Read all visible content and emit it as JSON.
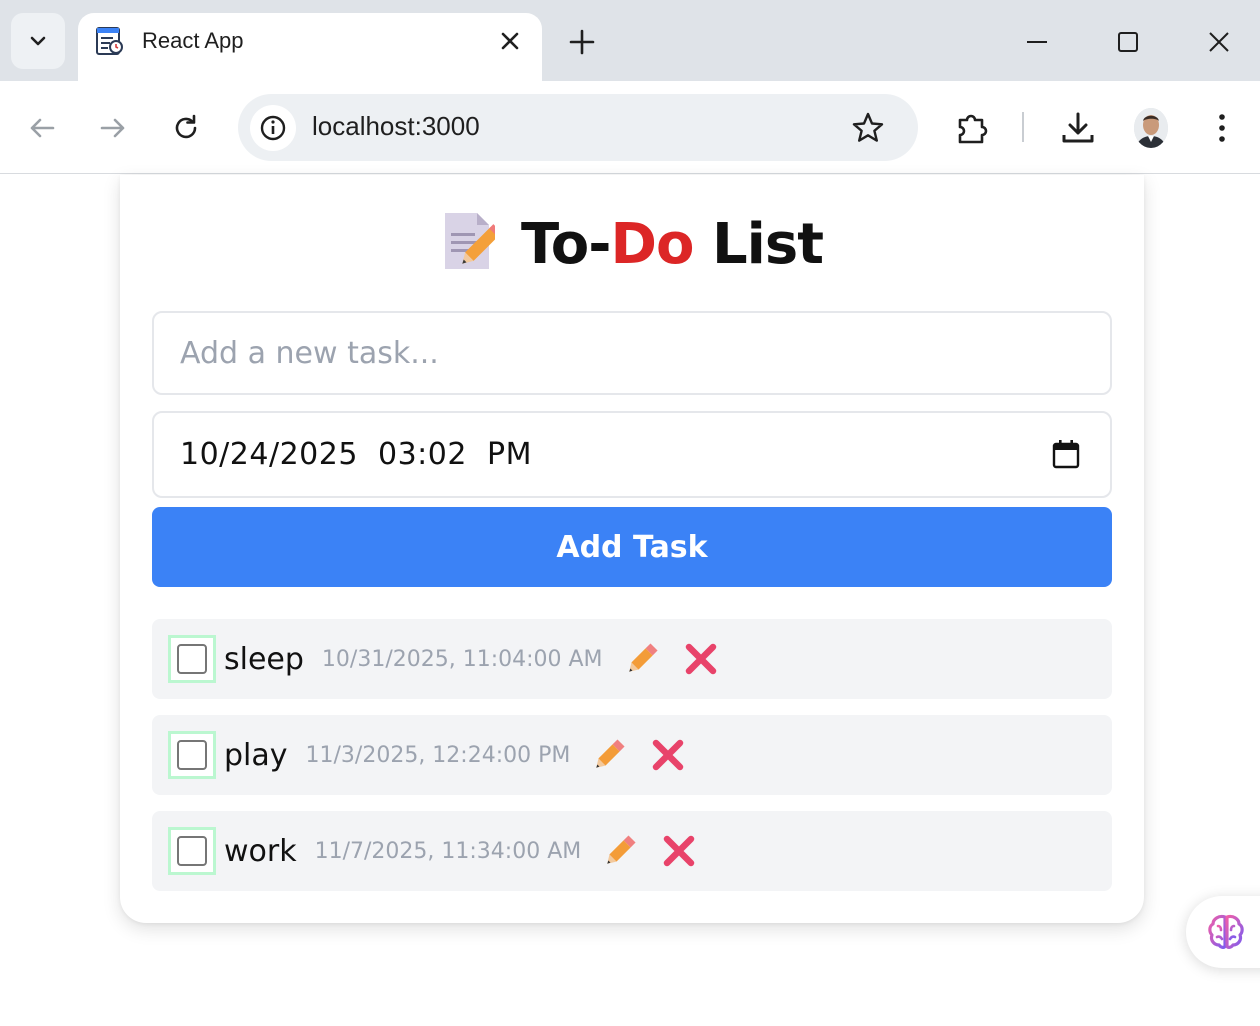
{
  "browser": {
    "tab_title": "React App",
    "url": "localhost:3000",
    "icons": [
      "tab-search-icon",
      "favicon-icon",
      "close-tab-icon",
      "new-tab-icon",
      "minimize-icon",
      "maximize-icon",
      "close-window-icon",
      "back-icon",
      "forward-icon",
      "reload-icon",
      "site-info-icon",
      "bookmark-star-icon",
      "extensions-icon",
      "download-icon",
      "profile-avatar",
      "menu-dots-icon"
    ]
  },
  "app": {
    "title_prefix": "To-",
    "title_highlight": "Do",
    "title_suffix": " List",
    "title_icon": "memo-icon",
    "task_input_placeholder": "Add a new task...",
    "date_value": "10/24/2025  03:02  PM",
    "add_button_label": "Add Task",
    "accent_color": "#3b82f6",
    "highlight_color": "#dc2626",
    "tasks": [
      {
        "name": "sleep",
        "due": "10/31/2025, 11:04:00 AM",
        "completed": false
      },
      {
        "name": "play",
        "due": "11/3/2025, 12:24:00 PM",
        "completed": false
      },
      {
        "name": "work",
        "due": "11/7/2025, 11:34:00 AM",
        "completed": false
      }
    ]
  }
}
